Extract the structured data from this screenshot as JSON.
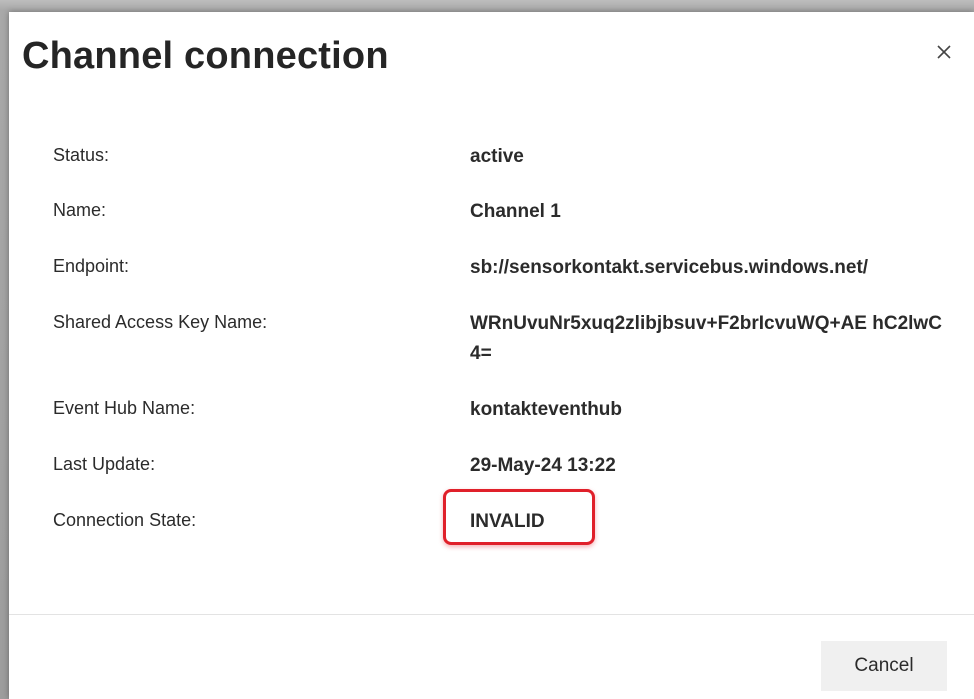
{
  "dialog": {
    "title": "Channel connection",
    "close_icon": "close-icon"
  },
  "fields": [
    {
      "label": "Status:",
      "value": "active"
    },
    {
      "label": "Name:",
      "value": "Channel 1"
    },
    {
      "label": "Endpoint:",
      "value": "sb://sensorkontakt.servicebus.windows.net/"
    },
    {
      "label": "Shared Access Key Name:",
      "value": "WRnUvuNr5xuq2zlibjbsuv+F2brIcvuWQ+AE hC2lwC4="
    },
    {
      "label": "Event Hub Name:",
      "value": "kontakteventhub"
    },
    {
      "label": "Last Update:",
      "value": "29-May-24 13:22"
    },
    {
      "label": "Connection State:",
      "value": "INVALID"
    }
  ],
  "footer": {
    "cancel_label": "Cancel"
  },
  "colors": {
    "highlight": "#e0202a",
    "cancel_bg": "#f0f0f0"
  }
}
